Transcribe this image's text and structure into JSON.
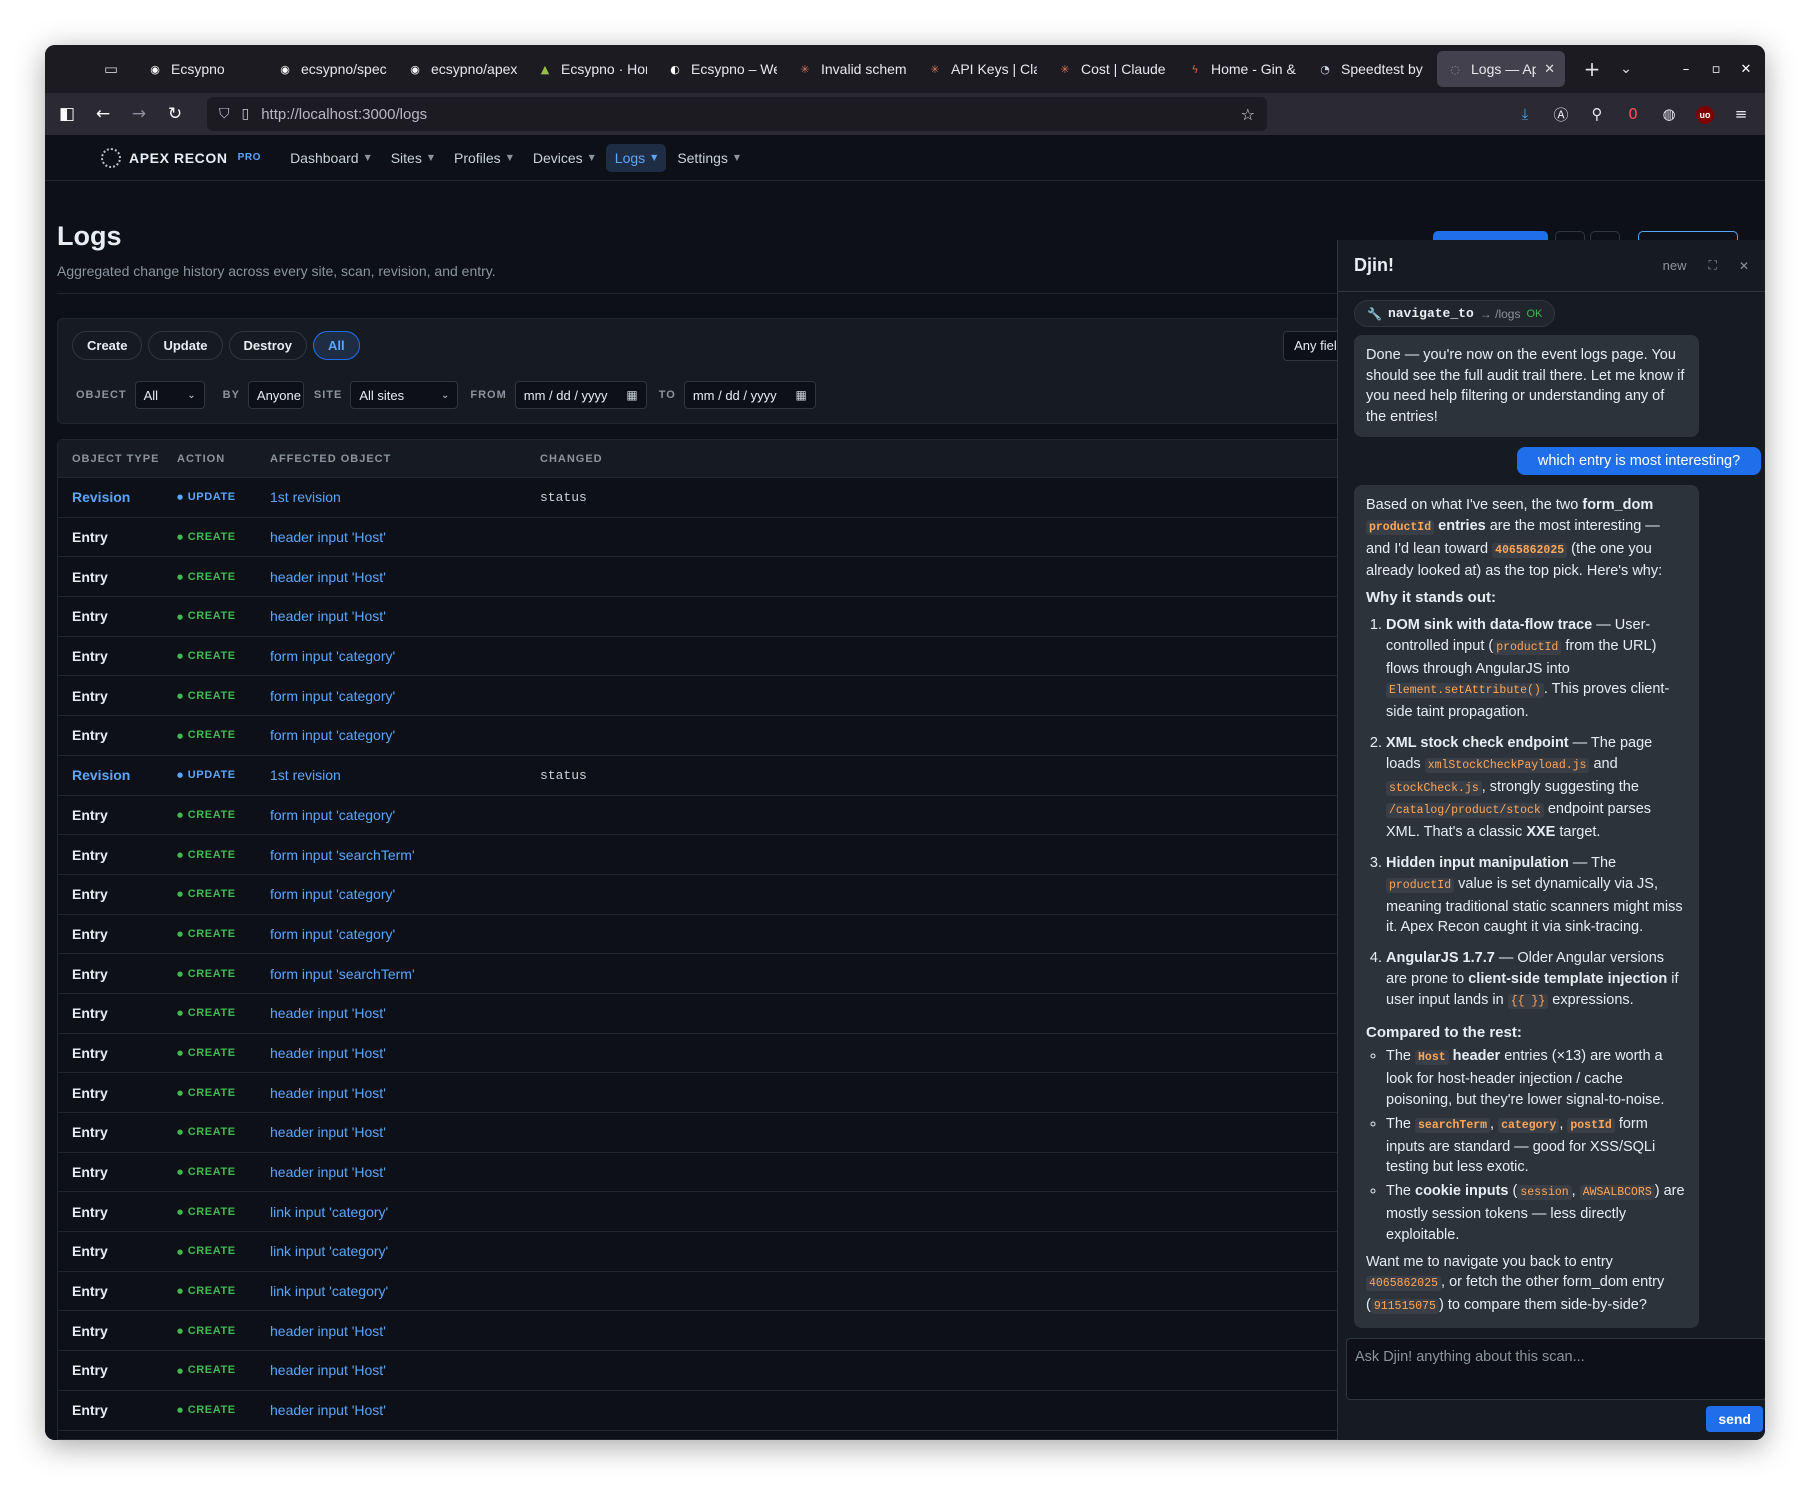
{
  "browser": {
    "tabs": [
      {
        "title": "Ecsypno",
        "icon": "github-icon",
        "fav_color": "#ffffff"
      },
      {
        "title": "ecsypno/spec",
        "icon": "github-icon",
        "fav_color": "#ffffff"
      },
      {
        "title": "ecsypno/apex",
        "icon": "github-icon",
        "fav_color": "#ffffff"
      },
      {
        "title": "Ecsypno · Hon",
        "icon": "shopify-icon",
        "fav_color": "#95bf47"
      },
      {
        "title": "Ecsypno – We",
        "icon": "edge-icon",
        "fav_color": "#ffffff"
      },
      {
        "title": "Invalid schem",
        "icon": "claude-icon",
        "fav_color": "#d97757"
      },
      {
        "title": "API Keys | Cla",
        "icon": "claude-icon",
        "fav_color": "#d97757"
      },
      {
        "title": "Cost | Claude",
        "icon": "claude-icon",
        "fav_color": "#d97757"
      },
      {
        "title": "Home - Gin &",
        "icon": "bolt-icon",
        "fav_color": "#ef5a3c"
      },
      {
        "title": "Speedtest by",
        "icon": "speedtest-icon",
        "fav_color": "#c9d1d9"
      },
      {
        "title": "Logs — Ape",
        "icon": "apex-icon",
        "fav_color": "#8b949e",
        "active": true
      }
    ],
    "url": "http://localhost:3000/logs",
    "notification_count": "0"
  },
  "app": {
    "brand": "APEX RECON",
    "brand_badge": "PRO",
    "menu": [
      {
        "label": "Dashboard"
      },
      {
        "label": "Sites"
      },
      {
        "label": "Profiles"
      },
      {
        "label": "Devices"
      },
      {
        "label": "Logs",
        "active": true
      },
      {
        "label": "Settings"
      }
    ]
  },
  "page": {
    "title": "Logs",
    "subtitle": "Aggregated change history across every site, scan, revision, and entry.",
    "filters": {
      "pills": [
        "Create",
        "Update",
        "Destroy",
        "All"
      ],
      "active_pill": "All",
      "search_placeholder": "Any field",
      "object_label": "OBJECT",
      "object_value": "All",
      "by_label": "BY",
      "by_value": "Anyone",
      "site_label": "SITE",
      "site_value": "All sites",
      "from_label": "FROM",
      "from_value": "mm / dd / yyyy",
      "to_label": "TO",
      "to_value": "mm / dd / yyyy"
    },
    "table": {
      "headers": [
        "OBJECT TYPE",
        "ACTION",
        "AFFECTED OBJECT",
        "CHANGED"
      ],
      "rows": [
        {
          "type": "Revision",
          "action": "UPDATE",
          "object": "1st revision",
          "changed": "status"
        },
        {
          "type": "Entry",
          "action": "CREATE",
          "object": "header input 'Host'",
          "changed": ""
        },
        {
          "type": "Entry",
          "action": "CREATE",
          "object": "header input 'Host'",
          "changed": ""
        },
        {
          "type": "Entry",
          "action": "CREATE",
          "object": "header input 'Host'",
          "changed": ""
        },
        {
          "type": "Entry",
          "action": "CREATE",
          "object": "form input 'category'",
          "changed": ""
        },
        {
          "type": "Entry",
          "action": "CREATE",
          "object": "form input 'category'",
          "changed": ""
        },
        {
          "type": "Entry",
          "action": "CREATE",
          "object": "form input 'category'",
          "changed": ""
        },
        {
          "type": "Revision",
          "action": "UPDATE",
          "object": "1st revision",
          "changed": "status"
        },
        {
          "type": "Entry",
          "action": "CREATE",
          "object": "form input 'category'",
          "changed": ""
        },
        {
          "type": "Entry",
          "action": "CREATE",
          "object": "form input 'searchTerm'",
          "changed": ""
        },
        {
          "type": "Entry",
          "action": "CREATE",
          "object": "form input 'category'",
          "changed": ""
        },
        {
          "type": "Entry",
          "action": "CREATE",
          "object": "form input 'category'",
          "changed": ""
        },
        {
          "type": "Entry",
          "action": "CREATE",
          "object": "form input 'searchTerm'",
          "changed": ""
        },
        {
          "type": "Entry",
          "action": "CREATE",
          "object": "header input 'Host'",
          "changed": ""
        },
        {
          "type": "Entry",
          "action": "CREATE",
          "object": "header input 'Host'",
          "changed": ""
        },
        {
          "type": "Entry",
          "action": "CREATE",
          "object": "header input 'Host'",
          "changed": ""
        },
        {
          "type": "Entry",
          "action": "CREATE",
          "object": "header input 'Host'",
          "changed": ""
        },
        {
          "type": "Entry",
          "action": "CREATE",
          "object": "header input 'Host'",
          "changed": ""
        },
        {
          "type": "Entry",
          "action": "CREATE",
          "object": "link input 'category'",
          "changed": ""
        },
        {
          "type": "Entry",
          "action": "CREATE",
          "object": "link input 'category'",
          "changed": ""
        },
        {
          "type": "Entry",
          "action": "CREATE",
          "object": "link input 'category'",
          "changed": ""
        },
        {
          "type": "Entry",
          "action": "CREATE",
          "object": "header input 'Host'",
          "changed": ""
        },
        {
          "type": "Entry",
          "action": "CREATE",
          "object": "header input 'Host'",
          "changed": ""
        },
        {
          "type": "Entry",
          "action": "CREATE",
          "object": "header input 'Host'",
          "changed": ""
        }
      ]
    }
  },
  "chat": {
    "title": "Djin!",
    "new_label": "new",
    "tool_call": {
      "name": "navigate_to",
      "arg": "→ /logs",
      "status": "OK"
    },
    "msg1": "Done — you're now on the event logs page. You should see the full audit trail there. Let me know if you need help filtering or understanding any of the entries!",
    "user_msg": "which entry is most interesting?",
    "reply": {
      "intro_a": "Based on what I've seen, the two ",
      "intro_b": "form_dom",
      "intro_c": "productId",
      "intro_d": " entries",
      "intro_e": " are the most interesting — and I'd lean toward ",
      "intro_f": "4065862025",
      "intro_g": " (the one you already looked at) as the top pick. Here's why:",
      "h1": "Why it stands out:",
      "p1_title": "DOM sink with data-flow trace",
      "p1_a": " — User-controlled input (",
      "p1_code1": "productId",
      "p1_b": " from the URL) flows through AngularJS into ",
      "p1_code2": "Element.setAttribute()",
      "p1_c": ". This proves client-side taint propagation.",
      "p2_title": "XML stock check endpoint",
      "p2_a": " — The page loads ",
      "p2_code1": "xmlStockCheckPayload.js",
      "p2_b": " and ",
      "p2_code2": "stockCheck.js",
      "p2_c": ", strongly suggesting the ",
      "p2_code3": "/catalog/product/stock",
      "p2_d": " endpoint parses XML. That's a classic ",
      "p2_e": "XXE",
      "p2_f": " target.",
      "p3_title": "Hidden input manipulation",
      "p3_a": " — The ",
      "p3_code1": "productId",
      "p3_b": " value is set dynamically via JS, meaning traditional static scanners might miss it. Apex Recon caught it via sink-tracing.",
      "p4_title": "AngularJS 1.7.7",
      "p4_a": " — Older Angular versions are prone to ",
      "p4_b": "client-side template injection",
      "p4_c": " if user input lands in ",
      "p4_code1": "{{ }}",
      "p4_d": " expressions.",
      "h2": "Compared to the rest:",
      "b1_a": "The ",
      "b1_code": "Host",
      "b1_b": " header",
      "b1_c": " entries (×13) are worth a look for host-header injection / cache poisoning, but they're lower signal-to-noise.",
      "b2_a": "The ",
      "b2_code1": "searchTerm",
      "b2_sep1": ", ",
      "b2_code2": "category",
      "b2_sep2": ", ",
      "b2_code3": "postId",
      "b2_b": " form inputs are standard — good for XSS/SQLi testing but less exotic.",
      "b3_a": "The ",
      "b3_b": "cookie inputs",
      "b3_c": " (",
      "b3_code1": "session",
      "b3_sep": ", ",
      "b3_code2": "AWSALBCORS",
      "b3_d": ") are mostly session tokens — less directly exploitable.",
      "outro_a": "Want me to navigate you back to entry ",
      "outro_code1": "4065862025",
      "outro_b": ", or fetch the other form_dom entry (",
      "outro_code2": "911515075",
      "outro_c": ") to compare them side-by-side?"
    },
    "input_placeholder": "Ask Djin! anything about this scan...",
    "send_label": "send"
  }
}
